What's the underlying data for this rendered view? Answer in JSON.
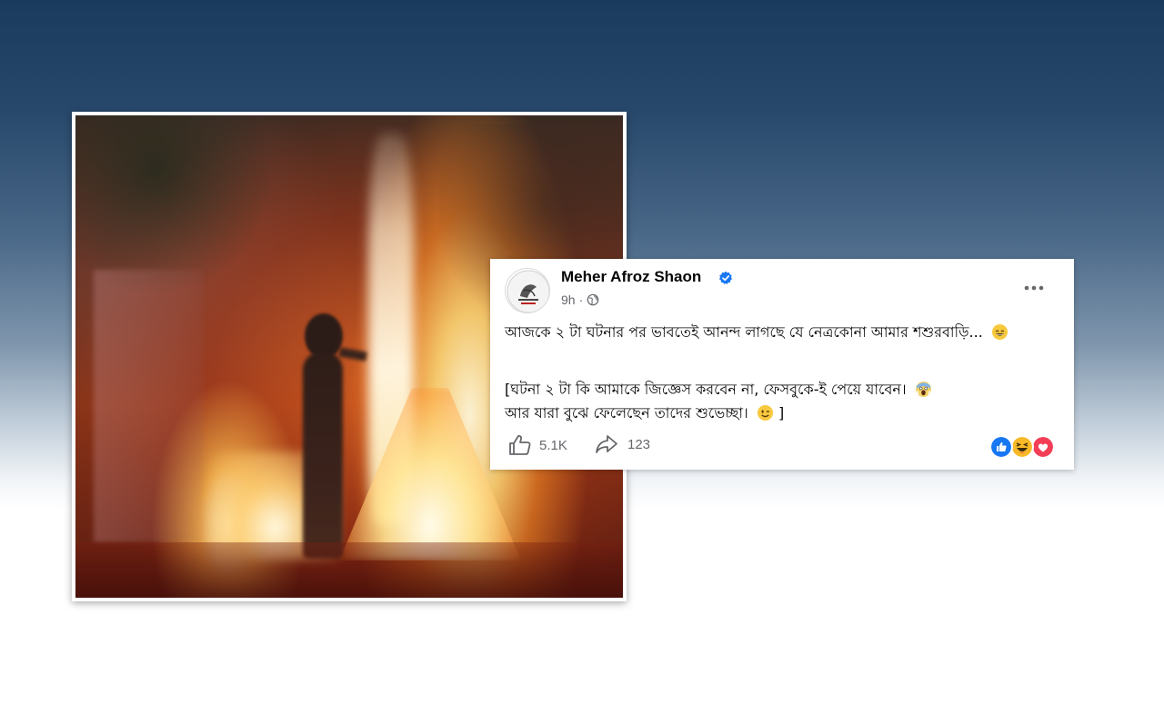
{
  "post": {
    "author": "Meher Afroz Shaon",
    "time": "9h",
    "meta_separator": "·",
    "paragraph1": "আজকে ২ টা ঘটনার পর ভাবতেই আনন্দ লাগছে যে নেত্রকোনা আমার শশুরবাড়ি...",
    "paragraph2": "[ঘটনা ২ টা কি আমাকে জিজ্ঞেস করবেন না, ফেসবুকে-ই পেয়ে যাবেন।",
    "paragraph2_line2": "আর যারা বুঝে ফেলেছেন তাদের শুভেচ্ছা।",
    "paragraph2_close": "]",
    "like_count": "5.1K",
    "share_count": "123",
    "icons": {
      "verified": "verified-badge-icon",
      "audience": "globe-icon",
      "more": "more-options-icon",
      "like": "thumbs-up-icon",
      "share": "share-arrow-icon"
    },
    "reactions": [
      "like",
      "haha",
      "love"
    ]
  },
  "colors": {
    "facebook_blue": "#1877f2",
    "text_primary": "#050505",
    "text_secondary": "#65676b",
    "love_red": "#f33e58",
    "haha_yellow": "#f7b928"
  }
}
